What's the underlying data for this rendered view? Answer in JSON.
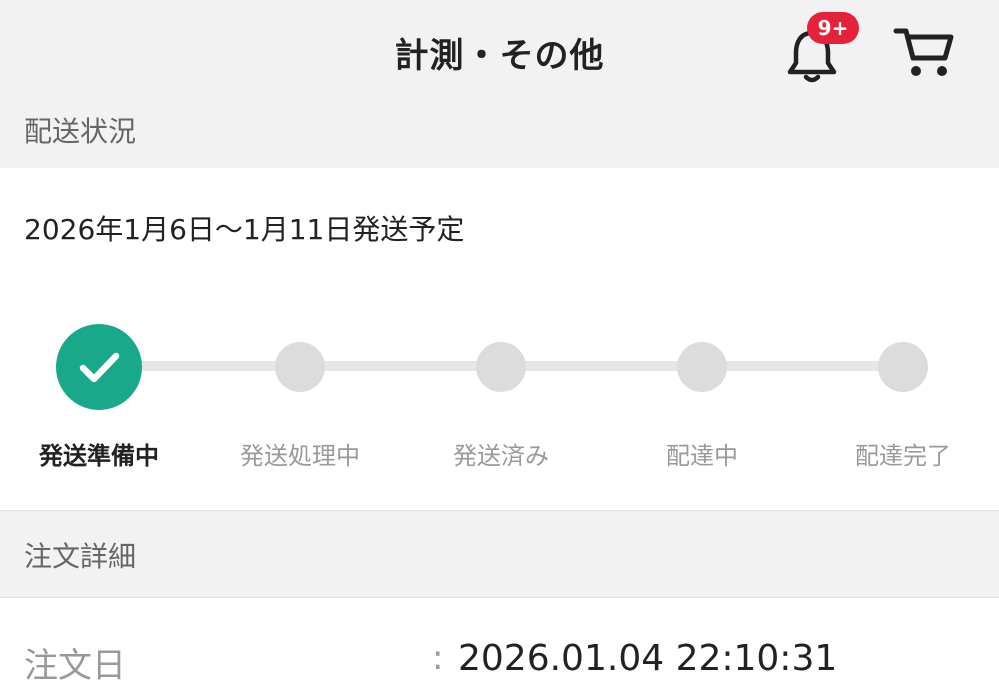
{
  "header": {
    "title": "計測・その他",
    "notification_badge": "9+",
    "icons": [
      "bell-icon",
      "cart-icon"
    ]
  },
  "shipping": {
    "section_title": "配送状況",
    "date_text": "2026年1月6日〜1月11日発送予定",
    "steps": [
      {
        "label": "発送準備中",
        "completed": true
      },
      {
        "label": "発送処理中",
        "completed": false
      },
      {
        "label": "発送済み",
        "completed": false
      },
      {
        "label": "配達中",
        "completed": false
      },
      {
        "label": "配達完了",
        "completed": false
      }
    ],
    "current_step": 1
  },
  "order": {
    "section_title": "注文詳細",
    "order_date_label": "注文日",
    "order_date_separator": ":",
    "order_date_value": "2026.01.04 22:10:31"
  },
  "colors": {
    "accent": "#1aa88a",
    "badge": "#e5223c",
    "inactive": "#dcdcdc"
  }
}
